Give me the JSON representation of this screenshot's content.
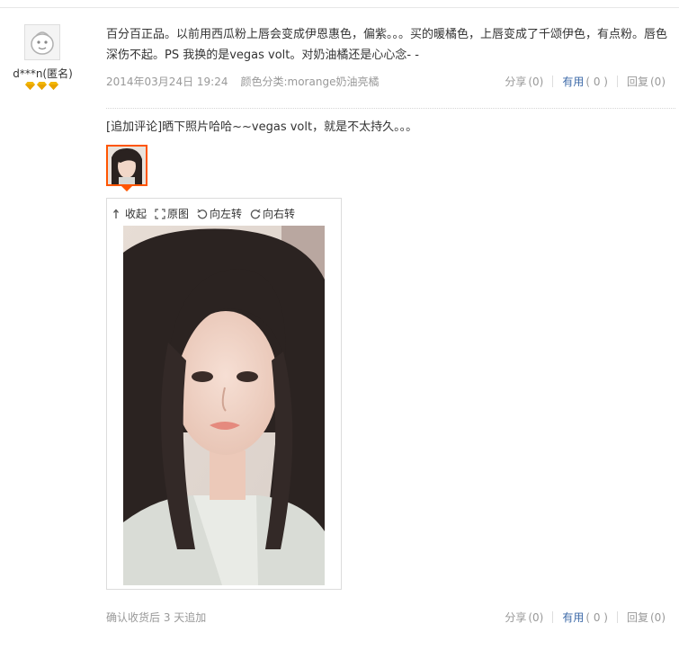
{
  "user": {
    "name": "d***n(匿名)",
    "avatar_icon": "default-avatar-icon",
    "rank_icons": [
      "diamond-icon",
      "diamond-icon",
      "diamond-icon"
    ],
    "rank_color": "#f2b705"
  },
  "review": {
    "text": "百分百正品。以前用西瓜粉上唇会变成伊恩惠色，偏紫。。。买的暖橘色，上唇变成了千颂伊色，有点粉。唇色深伤不起。PS 我换的是vegas volt。对奶油橘还是心心念- -",
    "date": "2014年03月24日 19:24",
    "sku": "颜色分类:morange奶油亮橘"
  },
  "actions": {
    "share_label": "分享",
    "share_count": "(0)",
    "useful_label": "有用",
    "useful_count": "( 0 )",
    "reply_label": "回复",
    "reply_count": "(0)"
  },
  "append": {
    "text": "[追加评论]晒下照片哈哈~~vegas volt，就是不太持久。。。",
    "footer": "确认收货后 3 天追加"
  },
  "viewer": {
    "collapse_label": "收起",
    "original_label": "原图",
    "rotate_left_label": "向左转",
    "rotate_right_label": "向右转"
  },
  "colors": {
    "accent_orange": "#ff5500",
    "link_blue": "#3d6aa8",
    "muted_gray": "#999999"
  }
}
